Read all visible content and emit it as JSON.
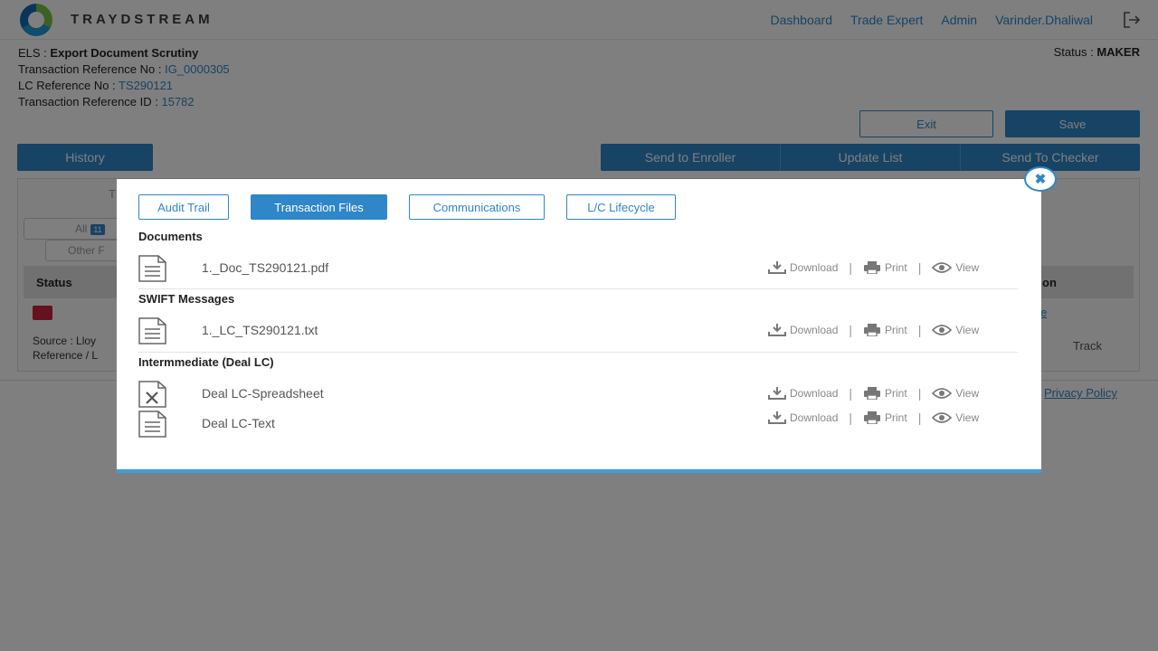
{
  "header": {
    "brand": "TRAYDSTREAM",
    "nav": [
      "Dashboard",
      "Trade Expert",
      "Admin",
      "Varinder.Dhaliwal"
    ]
  },
  "info": {
    "els_label": "ELS : ",
    "els_value": "Export Document Scrutiny",
    "txn_ref_label": "Transaction Reference No : ",
    "txn_ref_value": "IG_0000305",
    "lc_ref_label": "LC Reference No : ",
    "lc_ref_value": "TS290121",
    "txn_id_label": "Transaction Reference ID : ",
    "txn_id_value": "15782",
    "status_label": "Status : ",
    "status_value": "MAKER"
  },
  "buttons": {
    "exit": "Exit",
    "save": "Save",
    "history": "History",
    "send_to_enroller": "Send to Enroller",
    "update_list": "Update List",
    "send_to_checker": "Send To Checker"
  },
  "background": {
    "tab_t": "T",
    "all_pill": "All",
    "all_count": "11",
    "other_pill": "Other F",
    "th_status": "Status",
    "th_on": "on",
    "blue_e": "e",
    "source_line1": "Source : Lloy",
    "source_line2": "Reference / L",
    "track": "Track",
    "privacy": "Privacy Policy"
  },
  "modal": {
    "tabs": [
      "Audit Trail",
      "Transaction Files",
      "Communications",
      "L/C Lifecycle"
    ],
    "active_tab": "Transaction Files",
    "sections": [
      {
        "title": "Documents",
        "files": [
          {
            "name": "1._Doc_TS290121.pdf",
            "icon": "document-icon"
          }
        ]
      },
      {
        "title": "SWIFT Messages",
        "files": [
          {
            "name": "1._LC_TS290121.txt",
            "icon": "document-icon"
          }
        ]
      },
      {
        "title": "Intermmediate (Deal LC)",
        "files": [
          {
            "name": "Deal LC-Spreadsheet",
            "icon": "spreadsheet-icon"
          },
          {
            "name": "Deal LC-Text",
            "icon": "document-icon"
          }
        ]
      }
    ],
    "action_labels": {
      "download": "Download",
      "print": "Print",
      "view": "View"
    }
  },
  "colors": {
    "accent": "#2f86c8",
    "overlay": "rgba(0,0,0,0.5)",
    "status_red": "#c8243a"
  }
}
